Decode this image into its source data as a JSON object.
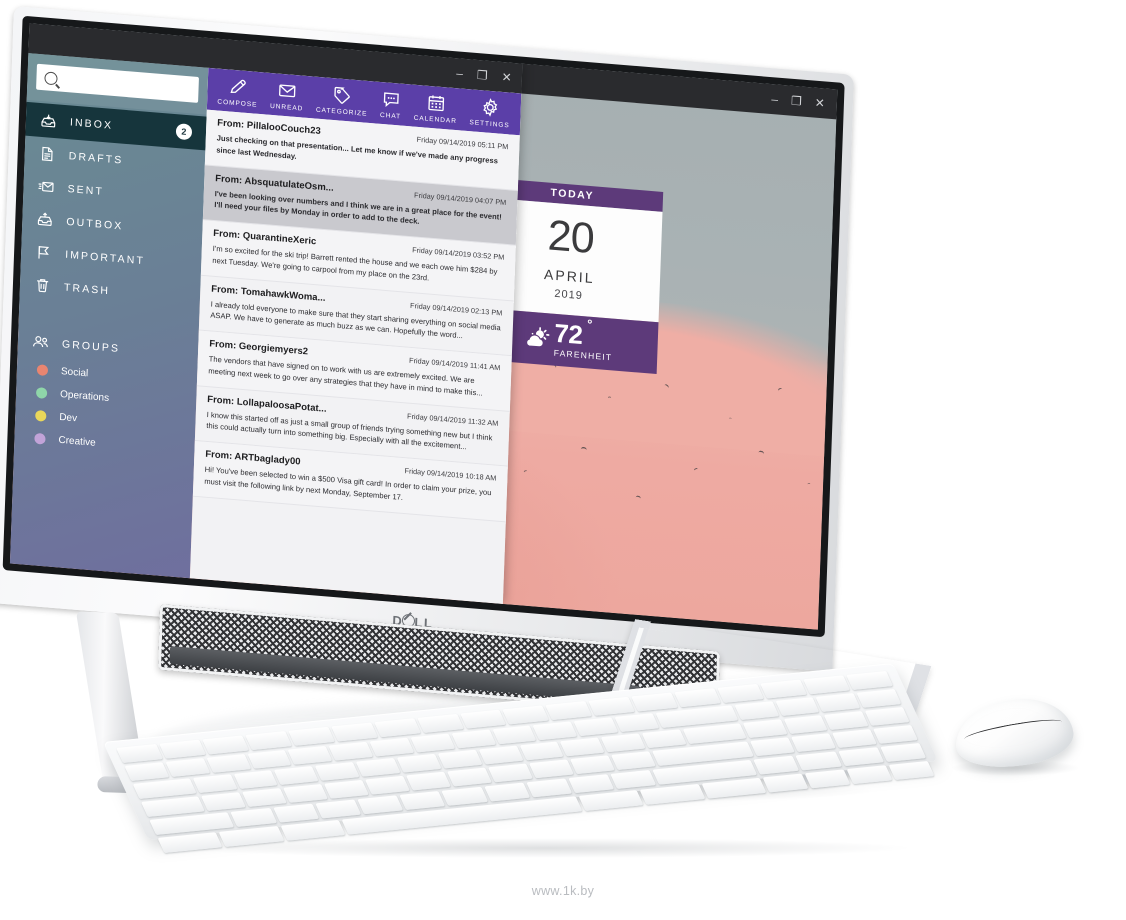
{
  "product": {
    "brand_logo": "DELL",
    "watermark": "www.1k.by"
  },
  "window_controls": {
    "minimize": "–",
    "maximize": "❐",
    "close": "✕"
  },
  "mail_app": {
    "search": {
      "placeholder": "",
      "value": "",
      "icon": "search-icon"
    },
    "toolbar": [
      {
        "label": "COMPOSE",
        "icon": "pencil-icon"
      },
      {
        "label": "UNREAD",
        "icon": "envelope-icon"
      },
      {
        "label": "CATEGORIZE",
        "icon": "tag-icon"
      },
      {
        "label": "CHAT",
        "icon": "chat-bubble-icon"
      },
      {
        "label": "CALENDAR",
        "icon": "calendar-icon"
      },
      {
        "label": "SETTINGS",
        "icon": "gear-icon"
      }
    ],
    "nav": [
      {
        "label": "INBOX",
        "icon": "inbox-tray-icon",
        "badge": "2",
        "active": true
      },
      {
        "label": "DRAFTS",
        "icon": "document-icon",
        "badge": "",
        "active": false
      },
      {
        "label": "SENT",
        "icon": "sent-mail-icon",
        "badge": "",
        "active": false
      },
      {
        "label": "OUTBOX",
        "icon": "outbox-tray-icon",
        "badge": "",
        "active": false
      },
      {
        "label": "IMPORTANT",
        "icon": "flag-icon",
        "badge": "",
        "active": false
      },
      {
        "label": "TRASH",
        "icon": "trash-icon",
        "badge": "",
        "active": false
      }
    ],
    "groups_header": {
      "label": "GROUPS",
      "icon": "people-icon"
    },
    "groups": [
      {
        "label": "Social",
        "color": "#e98570"
      },
      {
        "label": "Operations",
        "color": "#8fd6a9"
      },
      {
        "label": "Dev",
        "color": "#ead75a"
      },
      {
        "label": "Creative",
        "color": "#c2a3d8"
      }
    ],
    "messages": [
      {
        "from": "From: PillalooCouch23",
        "date": "Friday 09/14/2019 05:11 PM",
        "preview": "Just checking on that presentation... Let me know if we've made any progress since last Wednesday.",
        "highlighted": false,
        "unread": true
      },
      {
        "from": "From: AbsquatulateOsm...",
        "date": "Friday 09/14/2019 04:07 PM",
        "preview": "I've been looking over numbers and I think we are in a great place for the event! I'll need your files by Monday in order to add to the deck.",
        "highlighted": true,
        "unread": true
      },
      {
        "from": "From: QuarantineXeric",
        "date": "Friday 09/14/2019 03:52 PM",
        "preview": "I'm so excited for the ski trip! Barrett rented the house and we each owe him $284 by next Tuesday. We're going to carpool from my place on the 23rd.",
        "highlighted": false,
        "unread": false
      },
      {
        "from": "From: TomahawkWoma...",
        "date": "Friday 09/14/2019 02:13 PM",
        "preview": "I already told everyone to make sure that they start sharing everything on social media ASAP. We have to generate as much buzz as we can. Hopefully the word...",
        "highlighted": false,
        "unread": false
      },
      {
        "from": "From: Georgiemyers2",
        "date": "Friday 09/14/2019 11:41 AM",
        "preview": "The vendors that have signed on to work with us are extremely excited. We are meeting next week to go over any strategies that they have in mind to make this...",
        "highlighted": false,
        "unread": false
      },
      {
        "from": "From: LollapaloosaPotat...",
        "date": "Friday 09/14/2019 11:32 AM",
        "preview": "I know this started off as just a small group of friends trying something new but I think this could actually turn into something big. Especially with all the excitement...",
        "highlighted": false,
        "unread": false
      },
      {
        "from": "From: ARTbaglady00",
        "date": "Friday 09/14/2019 10:18 AM",
        "preview": "Hi! You've been selected to win a $500 Visa gift card! In order to claim your prize, you must visit the following link by next Monday, September 17.",
        "highlighted": false,
        "unread": false
      }
    ]
  },
  "calendar_widget": {
    "header": "TODAY",
    "day": "20",
    "month": "APRIL",
    "year": "2019",
    "weather": {
      "temperature": "72",
      "degree_symbol": "°",
      "unit": "FARENHEIT",
      "icon": "sun-behind-cloud-icon"
    }
  },
  "colors": {
    "toolbar_purple": "#5b3fa8",
    "widget_purple": "#5d3a7a",
    "sidebar_teal": "#6a8c93",
    "sidebar_violet": "#6f6f9e",
    "active_nav": "#16353c"
  }
}
